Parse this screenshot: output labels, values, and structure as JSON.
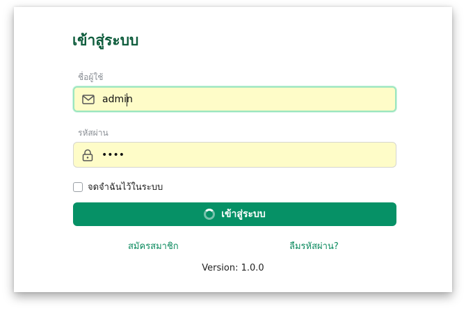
{
  "login": {
    "title": "เข้าสู่ระบบ",
    "username_label": "ชื่อผู้ใช้",
    "username_value": "admin",
    "password_label": "รหัสผ่าน",
    "password_value": "••••",
    "remember_label": "จดจำฉันไว้ในระบบ",
    "remember_checked": false,
    "submit_label": "เข้าสู่ระบบ",
    "register_link": "สมัครสมาชิก",
    "forgot_link": "ลืมรหัสผ่าน?",
    "version": "Version: 1.0.0"
  },
  "icons": {
    "username": "mail-icon",
    "password": "lock-icon",
    "submit": "spinner-icon"
  },
  "colors": {
    "primary": "#069166",
    "title": "#0e5c3c",
    "link": "#0b8a5e",
    "input_background": "#fefcc8",
    "focus_border": "#9be6bf"
  }
}
